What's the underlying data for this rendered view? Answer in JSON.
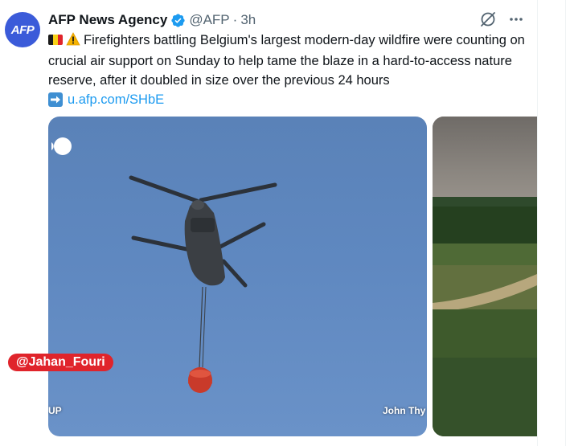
{
  "tweet": {
    "author_name": "AFP News Agency",
    "handle": "@AFP",
    "separator": "·",
    "time": "3h",
    "avatar_text": "AFP",
    "text": "Firefighters battling Belgium's largest modern-day wildfire were counting on crucial air support on Sunday to help tame the blaze in a hard-to-access nature reserve, after it doubled in size over the previous 24 hours",
    "link": "u.afp.com/SHbE"
  },
  "media": {
    "photo_1_credit_left": "UP",
    "photo_1_credit_right": "John Thy"
  },
  "watermark": "@Jahan_Fouri",
  "icons": {
    "verified": "verified-badge-icon",
    "grok": "grok-icon",
    "more": "more-icon",
    "flag": "belgium-flag-icon",
    "warning": "warning-icon",
    "arrow": "right-arrow-icon"
  },
  "colors": {
    "accent": "#1d9bf0",
    "text": "#0f1419",
    "secondary": "#536471",
    "watermark_bg": "#e0242b"
  }
}
